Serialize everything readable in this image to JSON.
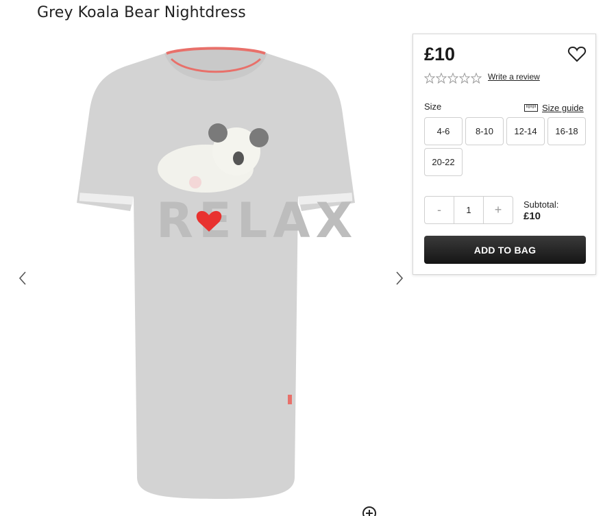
{
  "product": {
    "title": "Grey Koala Bear Nightdress",
    "image_alt": "Grey nightdress with koala and RELAX print"
  },
  "icons": {
    "prev": "chevron-left-icon",
    "next": "chevron-right-icon",
    "favourite": "heart-icon",
    "zoom": "zoom-in-icon",
    "ruler": "ruler-icon",
    "star": "star-outline-icon"
  },
  "panel": {
    "price": "£10",
    "rating": {
      "stars": 0,
      "max": 5
    },
    "write_review": "Write a review",
    "size_label": "Size",
    "size_guide": "Size guide",
    "sizes": [
      "4-6",
      "8-10",
      "12-14",
      "16-18",
      "20-22"
    ],
    "quantity": {
      "minus": "-",
      "value": "1",
      "plus": "+"
    },
    "subtotal_label": "Subtotal:",
    "subtotal_value": "£10",
    "add_to_bag": "ADD TO BAG"
  },
  "colors": {
    "button_dark": "#1f1f1f",
    "accent_pink": "#e8706a",
    "garment_grey": "#d4d4d4"
  }
}
